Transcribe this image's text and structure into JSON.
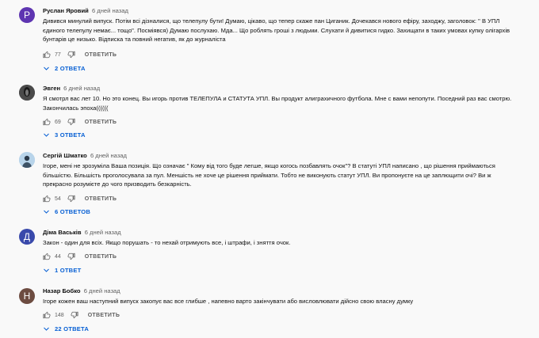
{
  "comments": [
    {
      "author": "Руслан Яровий",
      "time": "6 дней назад",
      "avatar_letter": "Р",
      "avatar_color": "#5e35b1",
      "text": "Дивився минулий випуск. Потім всі дізналися, що телепулу бути! Думаю, цікаво, що тепер скаже пан Циганик. Дочекався нового ефіру, заходжу, заголовок: \" В УПЛ єдиного телепулу немає... тощо\". Посміявся) Думаю послухаю. Мда... Що роблять гроші з людьми. Слухати й дивитися гидко. Захищати в таких умовах купку олігархів бунтарів це низько. Відписка та повний негатив, як до журналіста",
      "likes": "77",
      "reply_label": "ОТВЕТИТЬ",
      "replies_label": "2 ОТВЕТА"
    },
    {
      "author": "Эвген",
      "time": "6 дней назад",
      "avatar_letter": "",
      "avatar_color": "#3a3a3a",
      "text": "Я смотрл вас лет 10. Но это конец. Вы игорь против ТЕЛЕПУЛА и СТАТУТА УПЛ. Вы продукт алиграхичного футбола. Мне с вами непопути. Поседний раз вас смотрю. Закончилась эпоха((((((",
      "likes": "69",
      "reply_label": "ОТВЕТИТЬ",
      "replies_label": "3 ОТВЕТА"
    },
    {
      "author": "Сергій Шматко",
      "time": "6 дней назад",
      "avatar_letter": "",
      "avatar_color": "#a9c9e2",
      "text": "Ігоре, мені не зрозуміла Ваша позиція. Що означає \" Кому від того буде легше, якщо когось позбавлять очок\"? В статуті УПЛ написано , що рішення приймаються більшістю. Більшість проголосувала за пул. Меншість не хоче це рішення приймати. Тобто не виконують статут УПЛ. Ви пропонуєте на це заплющити очі? Ви ж прекрасно розумієте до чого призводить безкарність.",
      "likes": "54",
      "reply_label": "ОТВЕТИТЬ",
      "replies_label": "6 ОТВЕТОВ"
    },
    {
      "author": "Діма Васьків",
      "time": "6 дней назад",
      "avatar_letter": "Д",
      "avatar_color": "#3949ab",
      "text": "Закон - один для всіх. Якщо порушать - то нехай отримують все, і штрафи, і зняття очок.",
      "likes": "44",
      "reply_label": "ОТВЕТИТЬ",
      "replies_label": "1 ОТВЕТ"
    },
    {
      "author": "Назар Бобко",
      "time": "6 дней назад",
      "avatar_letter": "Н",
      "avatar_color": "#6d4c41",
      "text": "Ігоре кожен ваш наступний випуск закопує вас все глибше , напевно варто закінчувати або висловлювати дійсно свою власну думку",
      "likes": "148",
      "reply_label": "ОТВЕТИТЬ",
      "replies_label": "22 ОТВЕТА"
    }
  ]
}
